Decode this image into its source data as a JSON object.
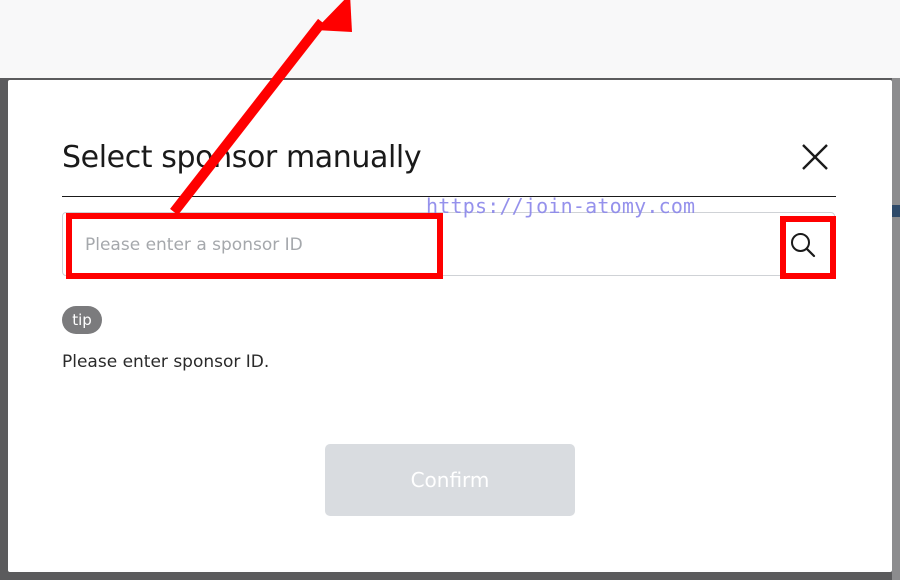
{
  "modal": {
    "title": "Select sponsor manually",
    "close_icon": "close-icon",
    "search": {
      "placeholder": "Please enter a sponsor ID",
      "value": "",
      "icon": "search-icon"
    },
    "tip_label": "tip",
    "help_text": "Please enter sponsor ID.",
    "confirm_label": "Confirm"
  },
  "watermark": "https://join-atomy.com",
  "colors": {
    "annotation": "#ff0000",
    "backdrop": "#5b5b5d",
    "confirm_disabled": "#d9dce0",
    "watermark": "#8a86ea"
  }
}
